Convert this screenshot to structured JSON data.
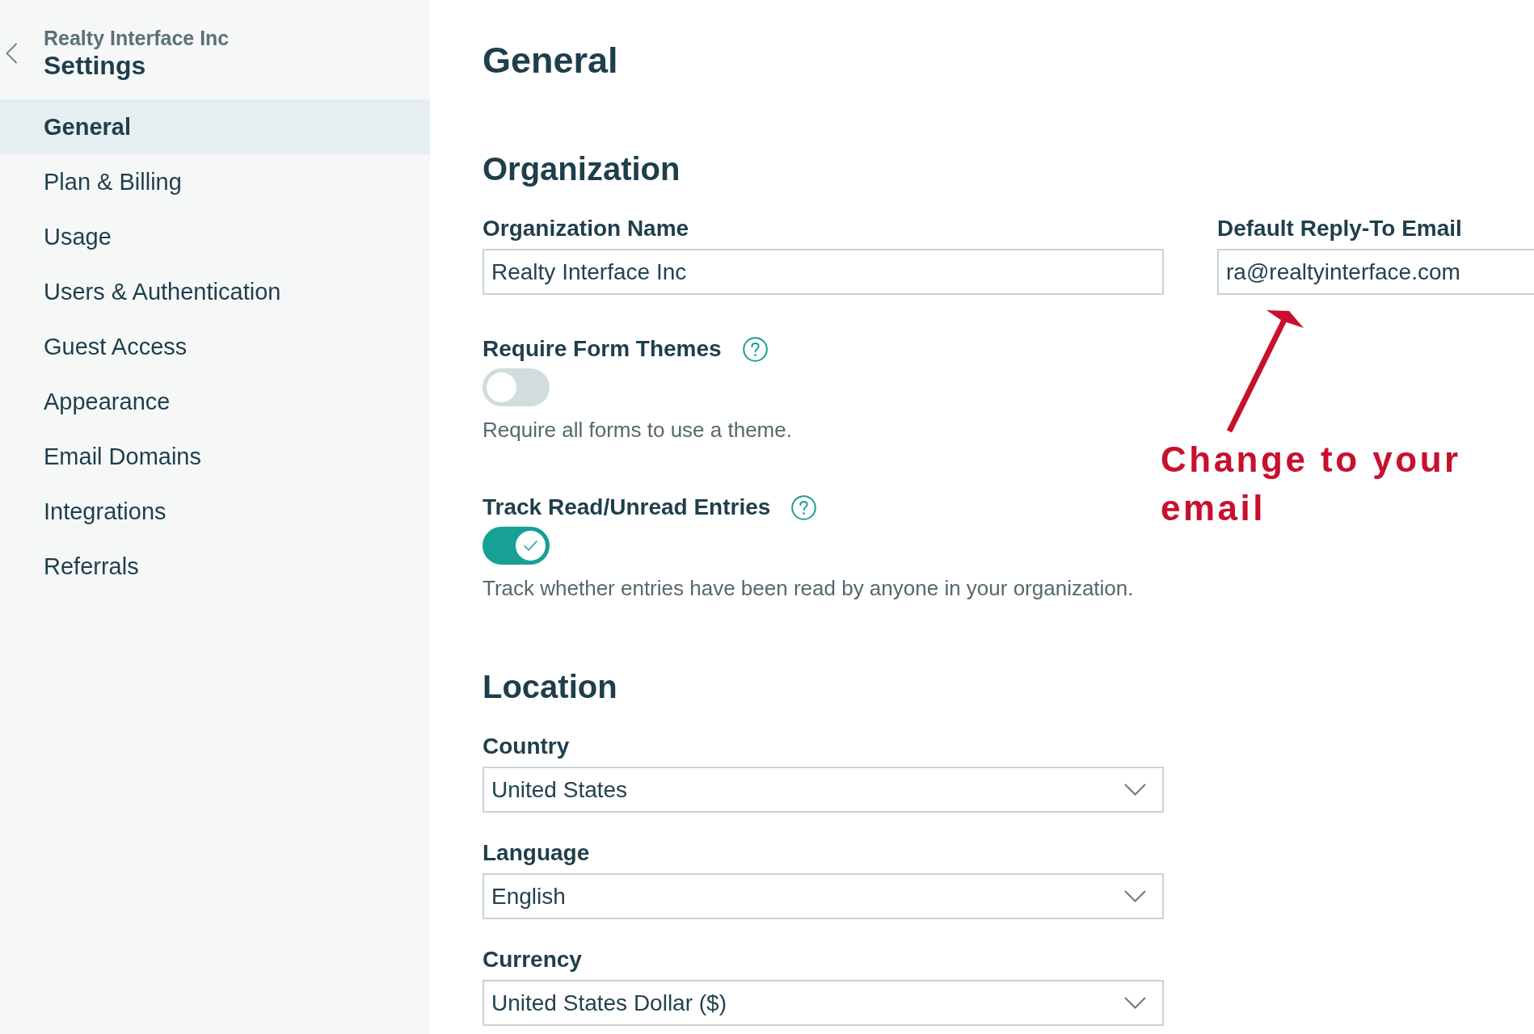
{
  "sidebar": {
    "organization": "Realty Interface Inc",
    "title": "Settings",
    "items": [
      {
        "label": "General",
        "selected": true
      },
      {
        "label": "Plan & Billing",
        "selected": false
      },
      {
        "label": "Usage",
        "selected": false
      },
      {
        "label": "Users & Authentication",
        "selected": false
      },
      {
        "label": "Guest Access",
        "selected": false
      },
      {
        "label": "Appearance",
        "selected": false
      },
      {
        "label": "Email Domains",
        "selected": false
      },
      {
        "label": "Integrations",
        "selected": false
      },
      {
        "label": "Referrals",
        "selected": false
      }
    ]
  },
  "page_title": "General",
  "sections": [
    {
      "title": "Organization",
      "fields": [
        {
          "kind": "text",
          "label": "Organization Name",
          "value": "Realty Interface Inc"
        },
        {
          "kind": "text",
          "label": "Default Reply-To Email",
          "value": "ra@realtyinterface.com"
        },
        {
          "kind": "toggle",
          "label": "Require Form Themes",
          "on": false,
          "description": "Require all forms to use a theme."
        },
        {
          "kind": "toggle",
          "label": "Track Read/Unread Entries",
          "on": true,
          "description": "Track whether entries have been read by anyone in your organization."
        }
      ]
    },
    {
      "title": "Location",
      "fields": [
        {
          "kind": "select",
          "label": "Country",
          "value": "United States"
        },
        {
          "kind": "select",
          "label": "Language",
          "value": "English"
        },
        {
          "kind": "select",
          "label": "Currency",
          "value": "United States Dollar ($)"
        }
      ]
    }
  ],
  "annotation": {
    "text": "Change to your email"
  }
}
